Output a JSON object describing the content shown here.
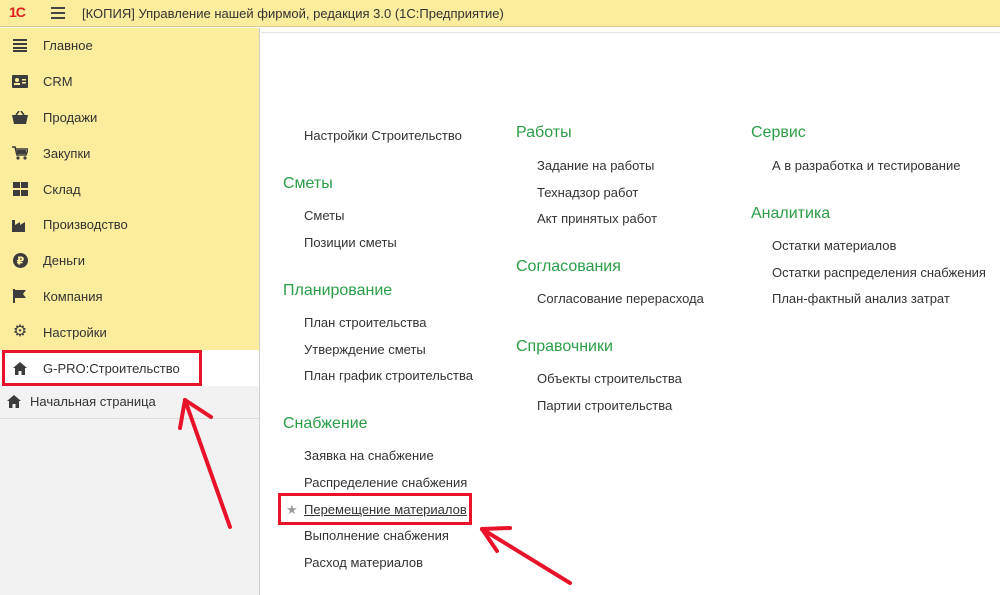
{
  "app": {
    "logo_text": "1С",
    "window_title": "[КОПИЯ] Управление нашей фирмой, редакция 3.0  (1С:Предприятие)"
  },
  "sidebar": {
    "sections": [
      {
        "label": "Главное",
        "icon": "list-icon"
      },
      {
        "label": "CRM",
        "icon": "contact-card-icon"
      },
      {
        "label": "Продажи",
        "icon": "basket-icon"
      },
      {
        "label": "Закупки",
        "icon": "cart-icon"
      },
      {
        "label": "Склад",
        "icon": "grid-icon"
      },
      {
        "label": "Производство",
        "icon": "factory-icon"
      },
      {
        "label": "Деньги",
        "icon": "ruble-coin-icon"
      },
      {
        "label": "Компания",
        "icon": "flag-icon"
      },
      {
        "label": "Настройки",
        "icon": "gear-icon"
      },
      {
        "label": "G-PRO:Строительство",
        "icon": "home-icon",
        "active": true
      }
    ],
    "home_link": "Начальная страница"
  },
  "content": {
    "col1": {
      "top_command": "Настройки Строительство",
      "groups": [
        {
          "title": "Сметы",
          "items": [
            "Сметы",
            "Позиции сметы"
          ]
        },
        {
          "title": "Планирование",
          "items": [
            "План строительства",
            "Утверждение сметы",
            "План график строительства"
          ]
        },
        {
          "title": "Снабжение",
          "items": [
            "Заявка на снабжение",
            "Распределение снабжения",
            "Перемещение материалов",
            "Выполнение снабжения",
            "Расход материалов"
          ]
        }
      ]
    },
    "col2": {
      "groups": [
        {
          "title": "Работы",
          "items": [
            "Задание на работы",
            "Технадзор работ",
            "Акт принятых работ"
          ]
        },
        {
          "title": "Согласования",
          "items": [
            "Согласование перерасхода"
          ]
        },
        {
          "title": "Справочники",
          "items": [
            "Объекты строительства",
            "Партии строительства"
          ]
        }
      ]
    },
    "col3": {
      "groups": [
        {
          "title": "Сервис",
          "items": [
            "А в разработка и тестирование"
          ]
        },
        {
          "title": "Аналитика",
          "items": [
            "Остатки материалов",
            "Остатки распределения снабжения",
            "План-фактный анализ затрат"
          ]
        }
      ]
    },
    "favorite_marker": "★"
  },
  "colors": {
    "accent_panel": "#fbec9e",
    "group_title": "#2a9d47",
    "highlight": "#e8132a"
  }
}
